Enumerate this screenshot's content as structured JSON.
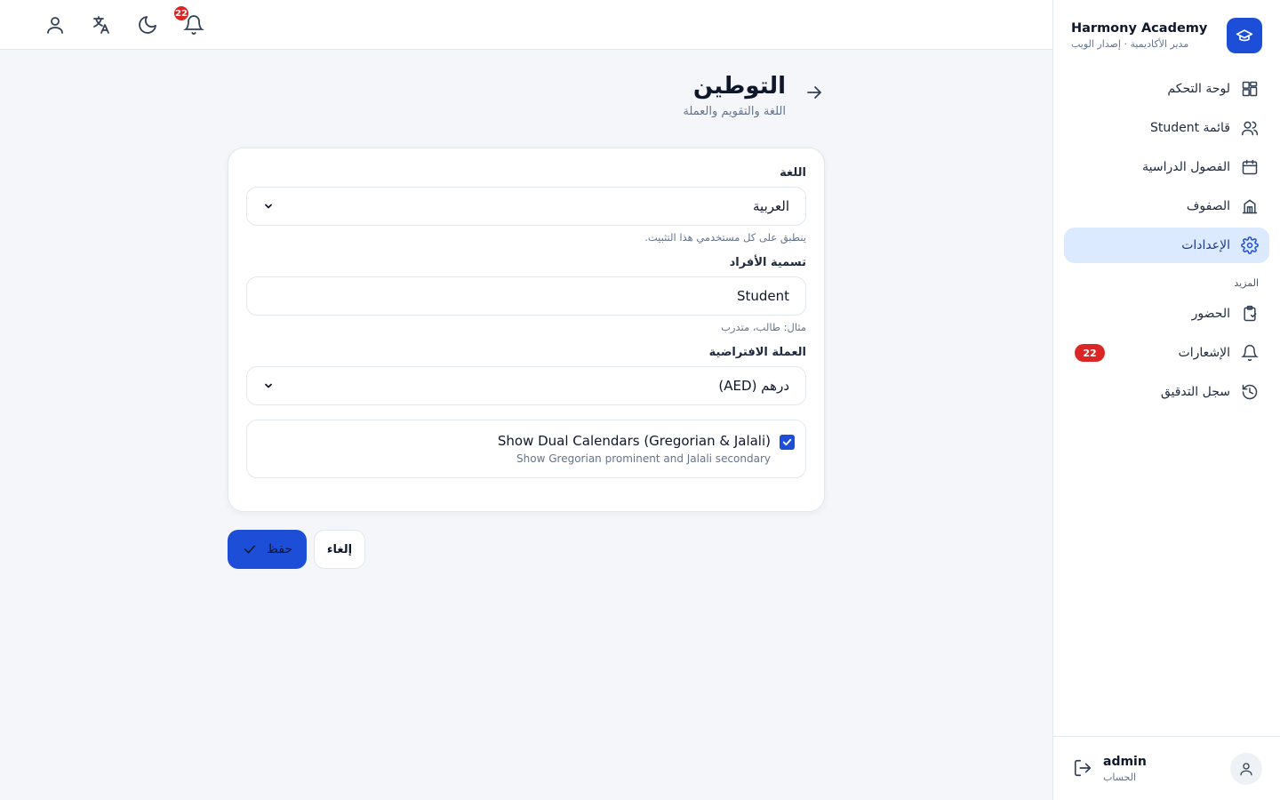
{
  "brand": {
    "name": "Harmony Academy",
    "subtitle": "مدير الأكاديمية · إصدار الويب"
  },
  "nav": {
    "items": [
      {
        "label": "لوحة التحكم",
        "icon": "dashboard-icon"
      },
      {
        "label": "قائمة Student",
        "icon": "users-icon"
      },
      {
        "label": "الفصول الدراسية",
        "icon": "calendar-icon"
      },
      {
        "label": "الصفوف",
        "icon": "building-icon"
      },
      {
        "label": "الإعدادات",
        "icon": "gear-icon",
        "active": true
      }
    ],
    "section_more": "المزيد",
    "more_items": [
      {
        "label": "الحضور",
        "icon": "clipboard-icon"
      },
      {
        "label": "الإشعارات",
        "icon": "bell-icon",
        "badge": "22"
      },
      {
        "label": "سجل التدقيق",
        "icon": "history-icon"
      }
    ]
  },
  "account": {
    "name": "admin",
    "subtitle": "الحساب"
  },
  "topbar": {
    "notification_count": "22"
  },
  "page": {
    "title": "التوطين",
    "subtitle": "اللغة والتقويم والعملة"
  },
  "form": {
    "language": {
      "label": "اللغة",
      "value": "العربية",
      "hint": "ينطبق على كل مستخدمي هذا التثبيت."
    },
    "people_label": {
      "label": "تسمية الأفراد",
      "value": "Student",
      "hint": "مثال: طالب، متدرب"
    },
    "currency": {
      "label": "العملة الافتراضية",
      "value": "درهم (AED)"
    },
    "dual_calendar": {
      "title": "Show Dual Calendars (Gregorian & Jalali)",
      "subtitle": "Show Gregorian prominent and Jalali secondary",
      "checked": true
    }
  },
  "actions": {
    "save": "حفظ",
    "cancel": "إلغاء"
  },
  "colors": {
    "accent": "#1d4ed8",
    "active_bg": "#dbeafe",
    "badge": "#dc2626"
  }
}
